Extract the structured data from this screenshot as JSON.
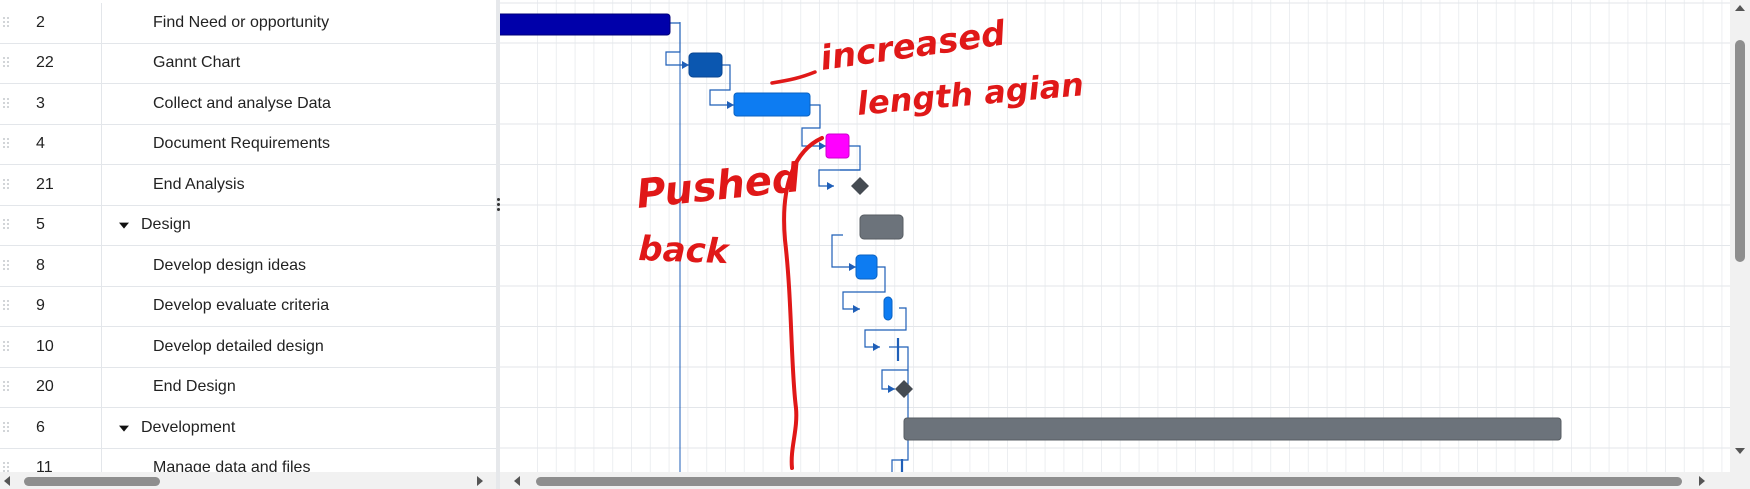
{
  "grid": {
    "rows": [
      {
        "id": "2",
        "name": "Find Need or opportunity",
        "level": 1,
        "summary": false
      },
      {
        "id": "22",
        "name": "Gannt Chart",
        "level": 1,
        "summary": false
      },
      {
        "id": "3",
        "name": "Collect and analyse Data",
        "level": 1,
        "summary": false
      },
      {
        "id": "4",
        "name": "Document Requirements",
        "level": 1,
        "summary": false
      },
      {
        "id": "21",
        "name": "End Analysis",
        "level": 1,
        "summary": false
      },
      {
        "id": "5",
        "name": "Design",
        "level": 0,
        "summary": true
      },
      {
        "id": "8",
        "name": "Develop design ideas",
        "level": 1,
        "summary": false
      },
      {
        "id": "9",
        "name": "Develop evaluate criteria",
        "level": 1,
        "summary": false
      },
      {
        "id": "10",
        "name": "Develop detailed design",
        "level": 1,
        "summary": false
      },
      {
        "id": "20",
        "name": "End Design",
        "level": 1,
        "summary": false
      },
      {
        "id": "6",
        "name": "Development",
        "level": 0,
        "summary": true
      },
      {
        "id": "11",
        "name": "Manage data and files",
        "level": 1,
        "summary": false
      }
    ]
  },
  "timeline": {
    "colors": {
      "dark_blue": "#0000aa",
      "mid_blue": "#0b57b0",
      "bright_blue": "#0d7cf2",
      "magenta": "#ff00ff",
      "summary_gray": "#6c737b",
      "milestone": "#454b52",
      "link": "#1f5fb8",
      "annotation": "#e01818"
    }
  },
  "annotations": {
    "increased_line1": "increased",
    "increased_line2": "length agian",
    "pushed_line1": "Pushed",
    "pushed_line2": "back"
  }
}
